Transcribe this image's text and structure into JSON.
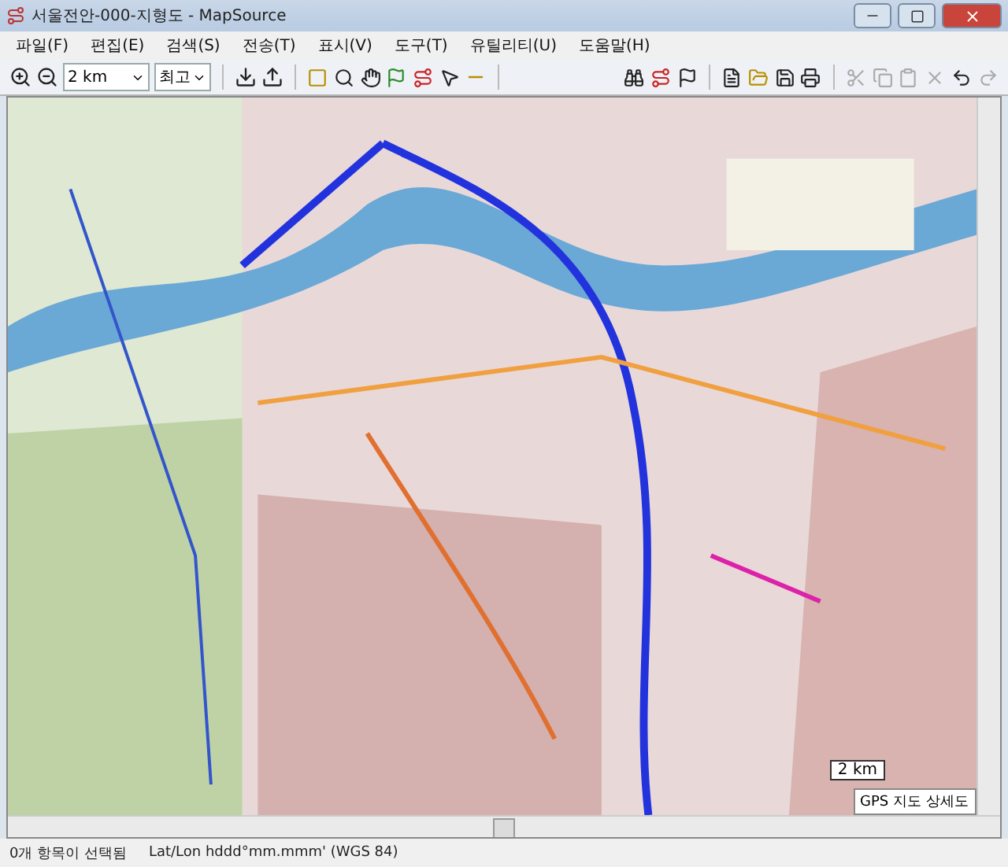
{
  "window": {
    "title": "서울전안-000-지형도 - MapSource"
  },
  "menu": [
    "파일(F)",
    "편집(E)",
    "검색(S)",
    "전송(T)",
    "표시(V)",
    "도구(T)",
    "유틸리티(U)",
    "도움말(H)"
  ],
  "toolbar": {
    "zoom_scale": "2 km",
    "detail": "최고"
  },
  "map": {
    "scale_label": "2 km",
    "detail_label": "GPS 지도 상세도"
  },
  "status_bar": [
    "0개 항목이 선택됨",
    "Lat/Lon hddd°mm.mmm' (WGS 84)"
  ]
}
